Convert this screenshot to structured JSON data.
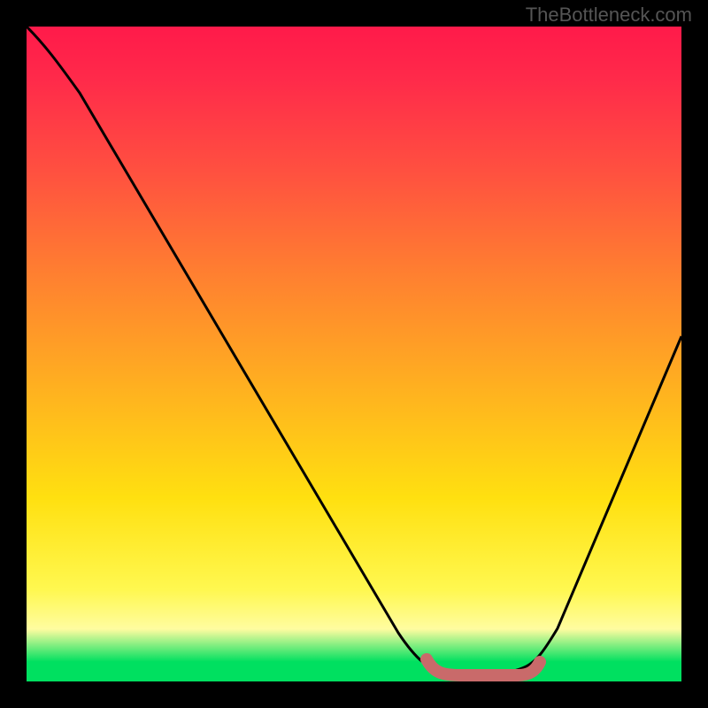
{
  "watermark": "TheBottleneck.com",
  "chart_data": {
    "type": "line",
    "title": "",
    "xlabel": "",
    "ylabel": "",
    "xlim": [
      0,
      100
    ],
    "ylim": [
      0,
      100
    ],
    "series": [
      {
        "name": "bottleneck-curve",
        "x": [
          0,
          5,
          10,
          20,
          30,
          40,
          50,
          58,
          62,
          68,
          72,
          78,
          85,
          92,
          100
        ],
        "values": [
          100,
          97,
          92,
          76,
          60,
          44,
          28,
          12,
          4,
          1,
          1,
          2,
          12,
          30,
          55
        ]
      },
      {
        "name": "optimal-range-marker",
        "x": [
          62,
          64,
          68,
          72,
          76,
          78
        ],
        "values": [
          3,
          1,
          1,
          1,
          1,
          3
        ]
      }
    ],
    "colors": {
      "curve": "#000000",
      "marker": "#c96a6a",
      "gradient_top": "#ff1a4a",
      "gradient_mid": "#ffe010",
      "gradient_bottom": "#00e060"
    }
  }
}
